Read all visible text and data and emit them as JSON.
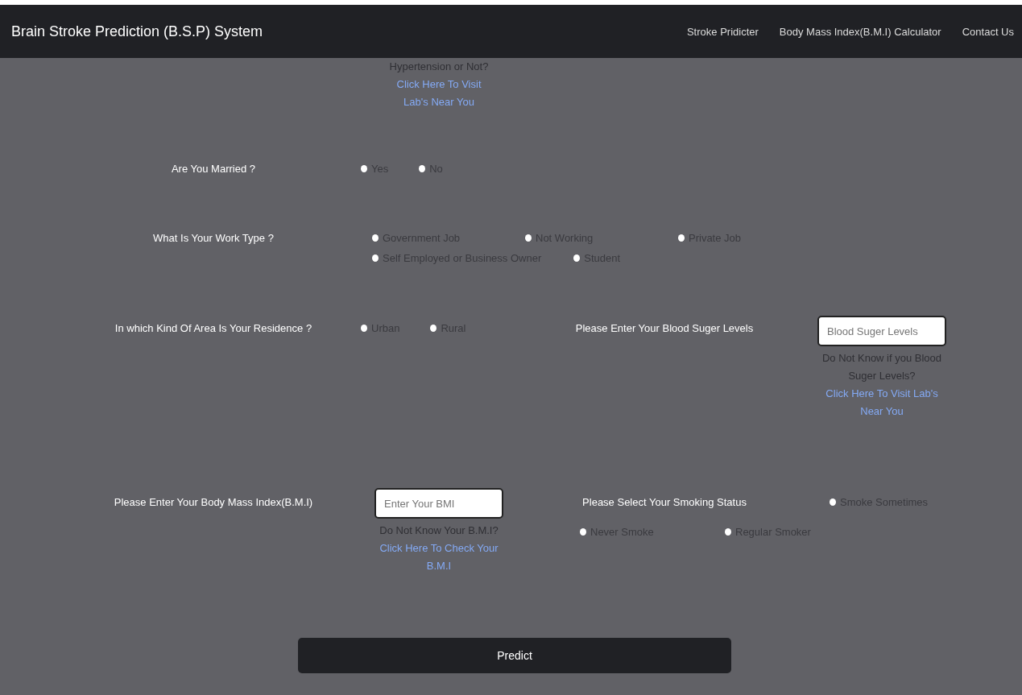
{
  "navbar": {
    "brand": "Brain Stroke Prediction (B.S.P) System",
    "links": [
      "Stroke Pridicter",
      "Body Mass Index(B.M.I) Calculator",
      "Contact Us"
    ]
  },
  "top_note": {
    "text": "Hypertension or Not?",
    "link": "Click Here To Visit Lab's Near You"
  },
  "married": {
    "label": "Are You Married ?",
    "options": [
      {
        "label": "Yes",
        "selected": false
      },
      {
        "label": "No",
        "selected": false
      }
    ]
  },
  "work_type": {
    "label": "What Is Your Work Type ?",
    "options": [
      {
        "label": "Government Job",
        "selected": false
      },
      {
        "label": "Not Working",
        "selected": false
      },
      {
        "label": "Private Job",
        "selected": false
      },
      {
        "label": "Self Employed or Business Owner",
        "selected": false
      },
      {
        "label": "Student",
        "selected": false
      }
    ]
  },
  "residence": {
    "label": "In which Kind Of Area Is Your Residence ?",
    "options": [
      {
        "label": "Urban",
        "selected": false
      },
      {
        "label": "Rural",
        "selected": false
      }
    ]
  },
  "blood_sugar": {
    "label": "Please Enter Your Blood Suger Levels",
    "placeholder": "Blood Suger Levels",
    "help": "Do Not Know if you Blood Suger Levels?",
    "link": "Click Here To Visit Lab's Near You"
  },
  "bmi": {
    "label": "Please Enter Your Body Mass Index(B.M.I)",
    "placeholder": "Enter Your BMI",
    "help": "Do Not Know Your B.M.I?",
    "link": "Click Here To Check Your B.M.I"
  },
  "smoking": {
    "label": "Please Select Your Smoking Status",
    "options": [
      {
        "label": "Smoke Sometimes",
        "selected": false
      },
      {
        "label": "Never Smoke",
        "selected": false
      },
      {
        "label": "Regular Smoker",
        "selected": false
      }
    ]
  },
  "predict_button": "Predict"
}
